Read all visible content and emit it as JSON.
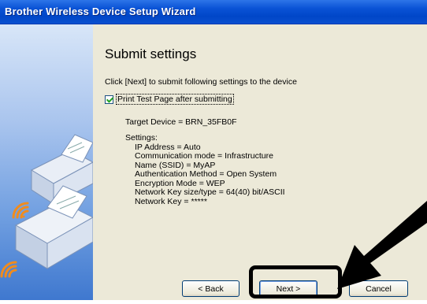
{
  "window": {
    "title": "Brother Wireless Device Setup Wizard"
  },
  "page": {
    "heading": "Submit settings",
    "instruction": "Click [Next] to submit following settings to the device",
    "checkbox": {
      "label": "Print Test Page after submitting",
      "checked": true
    },
    "target": "Target Device = BRN_35FB0F",
    "settings_header": "Settings:",
    "settings": [
      "IP Address = Auto",
      "Communication mode = Infrastructure",
      "Name (SSID) = MyAP",
      "Authentication Method = Open System",
      "Encryption Mode = WEP",
      "Network Key size/type = 64(40) bit/ASCII",
      "Network Key = *****"
    ]
  },
  "buttons": {
    "back": "< Back",
    "next": "Next >",
    "cancel": "Cancel"
  },
  "colors": {
    "title_bar": "#0a53d6",
    "panel_top": "#d8e6f8",
    "panel_bottom": "#3f78cf",
    "signal": "#f08c1e"
  }
}
